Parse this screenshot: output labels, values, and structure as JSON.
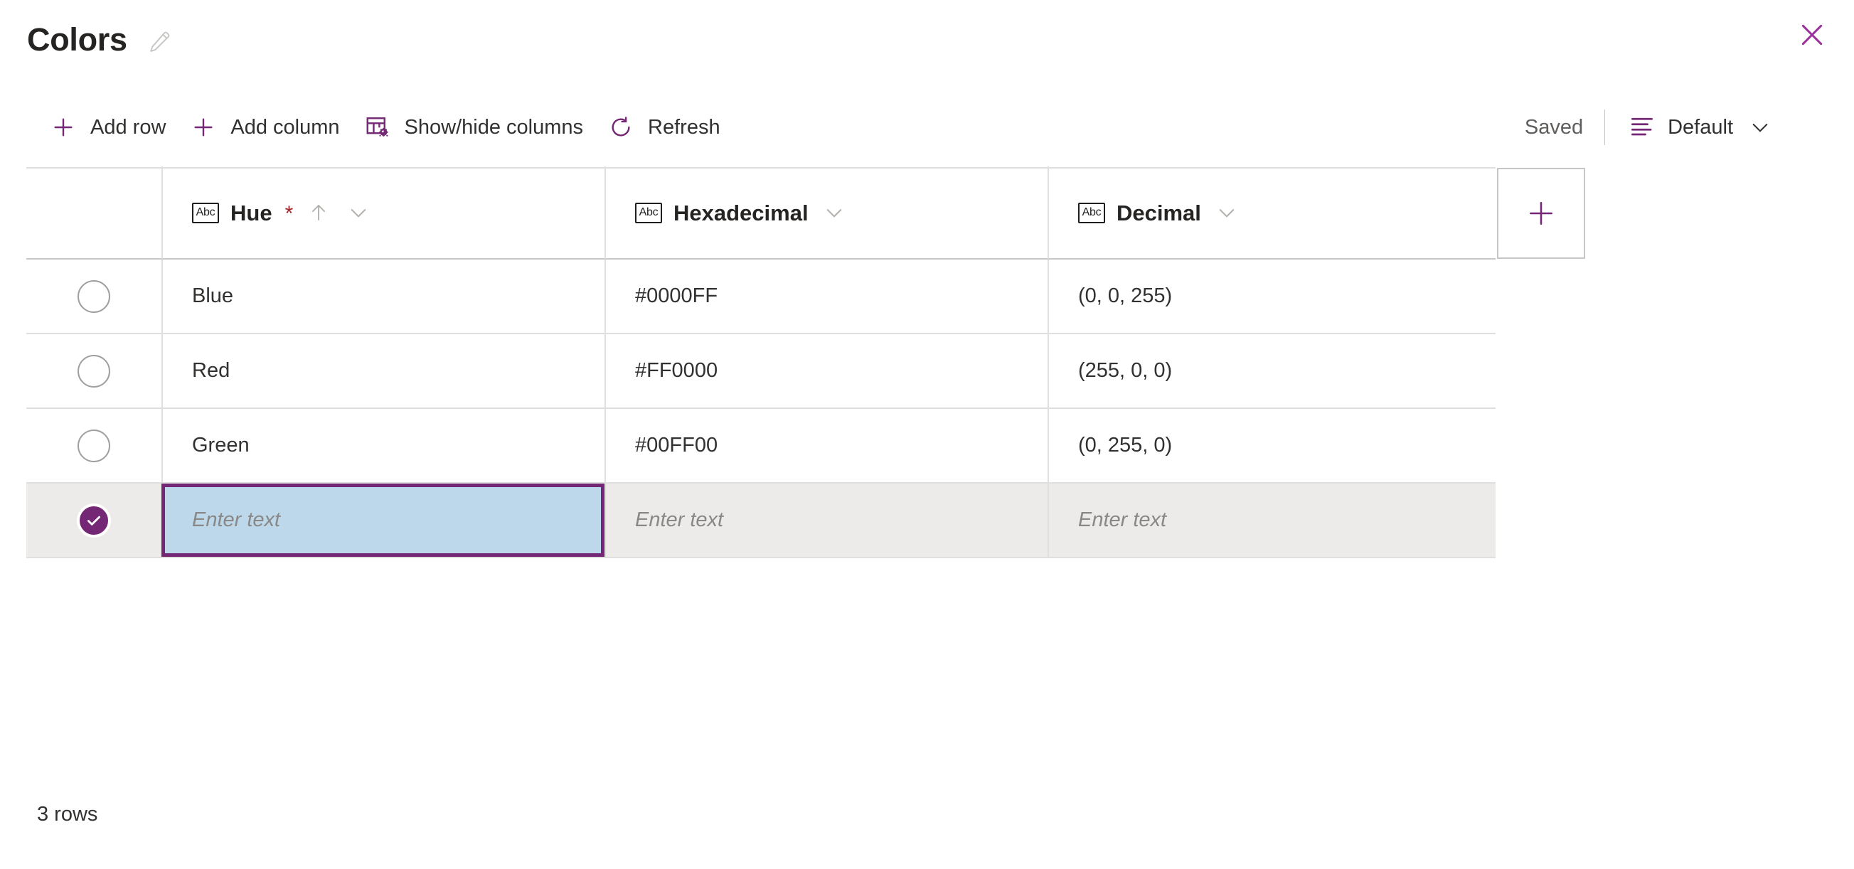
{
  "header": {
    "title": "Colors",
    "edit_icon": "pencil-icon",
    "close_icon": "close-icon"
  },
  "toolbar": {
    "buttons": [
      {
        "label": "Add row",
        "icon": "plus-icon"
      },
      {
        "label": "Add column",
        "icon": "plus-icon"
      },
      {
        "label": "Show/hide columns",
        "icon": "table-columns-settings-icon"
      },
      {
        "label": "Refresh",
        "icon": "refresh-icon"
      }
    ],
    "save_status": "Saved",
    "view": {
      "label": "Default",
      "icon": "view-list-icon",
      "chevron": "chevron-down-icon"
    }
  },
  "grid": {
    "columns": [
      {
        "name": "Hue",
        "type_badge": "Abc",
        "required": true,
        "required_marker": "*",
        "sort": "ascending",
        "sort_icon": "arrow-up-icon",
        "menu_icon": "chevron-down-icon"
      },
      {
        "name": "Hexadecimal",
        "type_badge": "Abc",
        "required": false,
        "required_marker": "",
        "sort": "none",
        "sort_icon": "",
        "menu_icon": "chevron-down-icon"
      },
      {
        "name": "Decimal",
        "type_badge": "Abc",
        "required": false,
        "required_marker": "",
        "sort": "none",
        "sort_icon": "",
        "menu_icon": "chevron-down-icon"
      }
    ],
    "add_column_button": {
      "icon": "plus-icon"
    },
    "rows": [
      {
        "selected": false,
        "hue": "Blue",
        "hexadecimal": "#0000FF",
        "decimal": "(0, 0, 255)"
      },
      {
        "selected": false,
        "hue": "Red",
        "hexadecimal": "#FF0000",
        "decimal": "(255, 0, 0)"
      },
      {
        "selected": false,
        "hue": "Green",
        "hexadecimal": "#00FF00",
        "decimal": "(0, 255, 0)"
      }
    ],
    "new_row": {
      "selected": true,
      "hue_placeholder": "Enter text",
      "hexadecimal_placeholder": "Enter text",
      "decimal_placeholder": "Enter text",
      "active_cell": "hue"
    }
  },
  "footer": {
    "row_count_text": "3 rows"
  },
  "colors": {
    "accent_purple": "#742774",
    "required_red": "#a4262c",
    "selected_cell_fill": "#bcd8ea",
    "new_row_bg": "#edebe9",
    "grid_line": "#e1dfdd",
    "text_primary": "#323130",
    "text_secondary": "#605e5c",
    "placeholder_text": "#8a8886"
  }
}
